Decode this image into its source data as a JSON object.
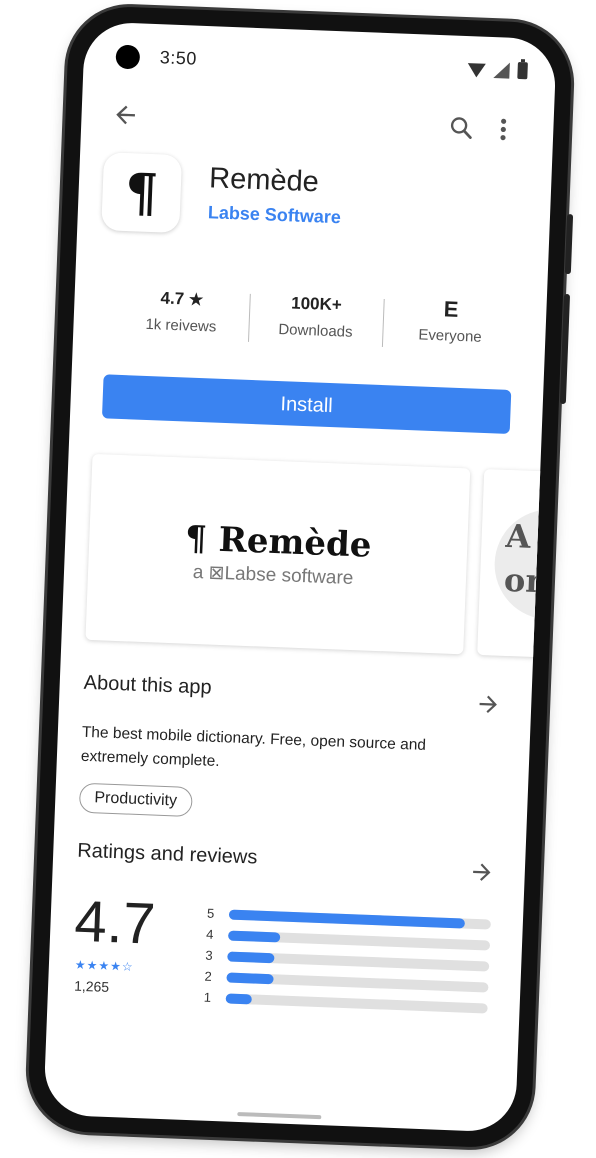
{
  "status": {
    "time": "3:50"
  },
  "app": {
    "name": "Remède",
    "developer": "Labse Software",
    "icon_glyph": "¶"
  },
  "stats": [
    {
      "value": "4.7",
      "label": "1k reivews",
      "icon": "star-icon"
    },
    {
      "value": "100K+",
      "label": "Downloads"
    },
    {
      "value": "E",
      "label": "Everyone"
    }
  ],
  "install_label": "Install",
  "screenshot": {
    "brand": "¶ Remède",
    "sub": "a ⊠Labse software",
    "next_text": "A m\none"
  },
  "about": {
    "title": "About this app",
    "description": "The best mobile dictionary. Free, open source and extremely complete.",
    "category": "Productivity"
  },
  "ratings": {
    "title": "Ratings and reviews",
    "score": "4.7",
    "count": "1,265",
    "stars": "★★★★☆",
    "bars": [
      {
        "label": "5",
        "fraction": 0.9
      },
      {
        "label": "4",
        "fraction": 0.2
      },
      {
        "label": "3",
        "fraction": 0.18
      },
      {
        "label": "2",
        "fraction": 0.18
      },
      {
        "label": "1",
        "fraction": 0.1
      }
    ]
  },
  "colors": {
    "accent": "#3a83f1"
  }
}
